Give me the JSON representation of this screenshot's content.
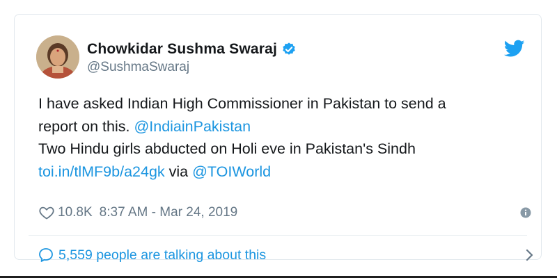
{
  "tweet": {
    "author_name": "Chowkidar Sushma Swaraj",
    "author_handle": "@SushmaSwaraj",
    "text_line1": "I have asked Indian High Commissioner in Pakistan to send a",
    "text_line2_plain": "report on this. ",
    "text_line2_mention": "@IndiainPakistan",
    "text_line3": "Two Hindu girls abducted on Holi eve in Pakistan's Sindh",
    "text_line4_link": "toi.in/tlMF9b/a24gk",
    "text_line4_via": " via ",
    "text_line4_mention": "@TOIWorld",
    "like_count": "10.8K",
    "timestamp": "8:37 AM - Mar 24, 2019",
    "talking_text": "5,559 people are talking about this"
  },
  "icons": {
    "verified": "verified-badge-icon",
    "bird": "twitter-bird-icon",
    "like": "heart-icon",
    "info": "info-icon",
    "reply": "speech-bubble-icon",
    "more": "chevron-right-icon"
  },
  "colors": {
    "link": "#1b95e0",
    "secondary_text": "#657786",
    "primary_text": "#14171a",
    "border": "#e1e8ed"
  }
}
